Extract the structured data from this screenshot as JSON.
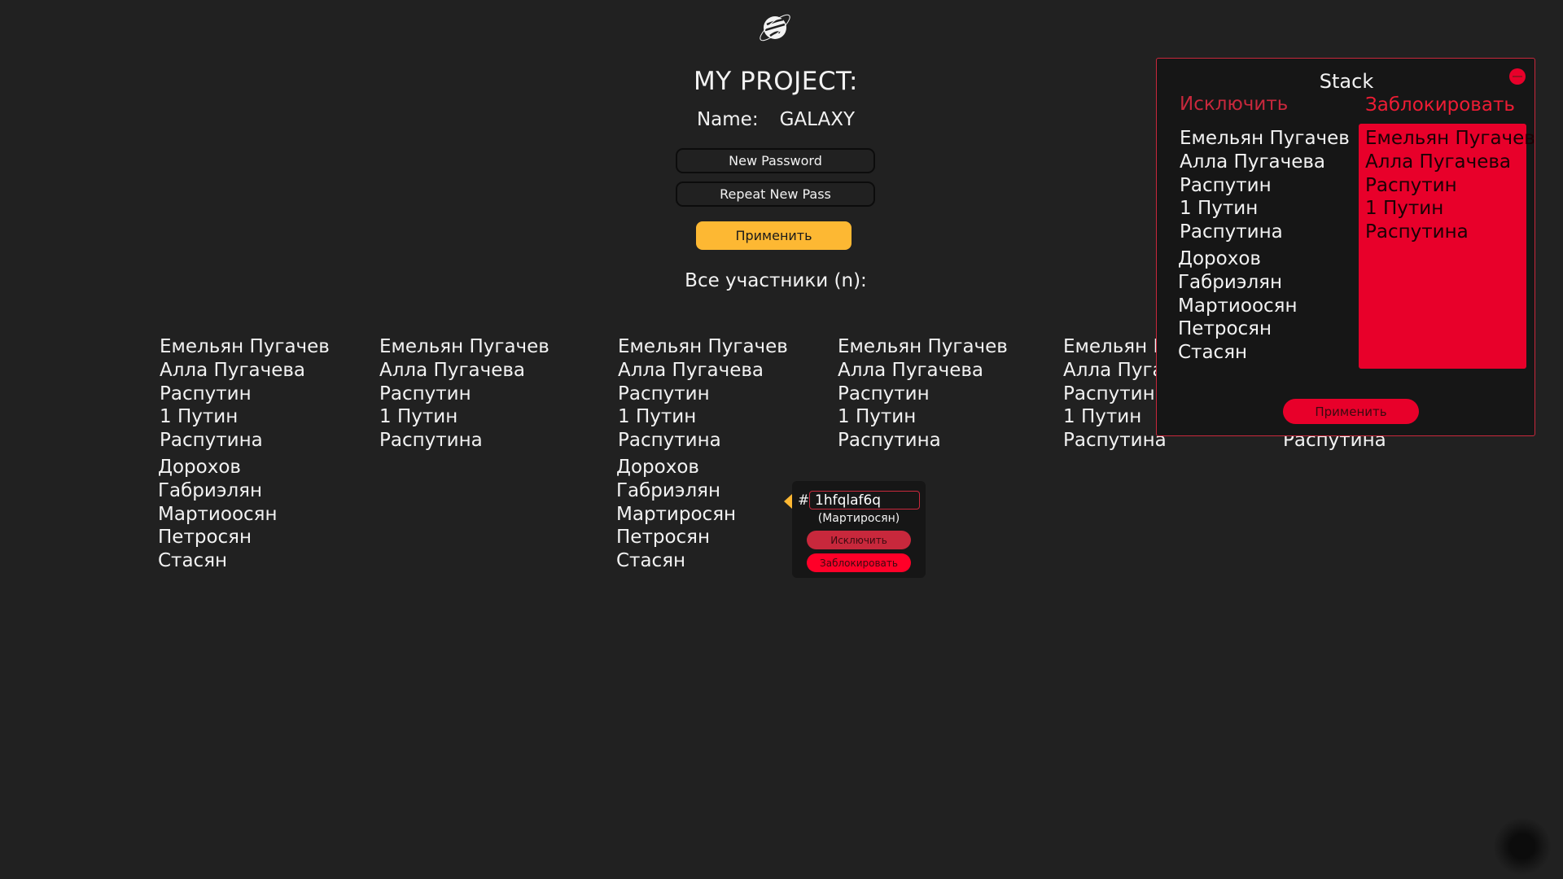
{
  "header": {
    "logo": "planet-logo",
    "title": "MY PROJECT:",
    "name_label": "Name:",
    "name_value": "GALAXY"
  },
  "form": {
    "new_password_placeholder": "New Password",
    "repeat_password_placeholder": "Repeat New Pass",
    "apply_label": "Применить",
    "accent": "#fdb833"
  },
  "members": {
    "title": "Все участники (n):",
    "columns": [
      {
        "group1": [
          "Емельян Пугачев",
          "Алла Пугачева",
          "Распутин",
          "1 Путин",
          "Распутина"
        ],
        "group2": [
          "Дорохов",
          "Габриэлян",
          "Мартиоосян",
          "Петросян",
          "Стасян"
        ]
      },
      {
        "group1": [
          "Емельян Пугачев",
          "Алла Пугачева",
          "Распутин",
          "1 Путин",
          "Распутина"
        ]
      },
      {
        "group1": [
          "Емельян Пугачев",
          "Алла Пугачева",
          "Распутин",
          "1 Путин",
          "Распутина"
        ],
        "group2": [
          "Дорохов",
          "Габриэлян",
          "Мартиросян",
          "Петросян",
          "Стасян"
        ]
      },
      {
        "group1": [
          "Емельян Пугачев",
          "Алла Пугачева",
          "Распутин",
          "1 Путин",
          "Распутина"
        ]
      },
      {
        "group1": [
          "Емельян Пугачев",
          "Алла Пугачева",
          "Распутин",
          "1 Путин",
          "Распутина"
        ]
      },
      {
        "group1": [
          "Распутина"
        ]
      }
    ]
  },
  "popup": {
    "hash": "#",
    "id_value": "1hfqlaf6q",
    "name": "(Мартиросян)",
    "exclude_label": "Исключить",
    "block_label": "Заблокировать"
  },
  "stack": {
    "title": "Stack",
    "exclude_header": "Исключить",
    "block_header": "Заблокировать",
    "exclude_group1": [
      "Емельян Пугачев",
      "Алла Пугачева",
      "Распутин",
      "1 Путин",
      "Распутина"
    ],
    "exclude_group2": [
      "Дорохов",
      "Габриэлян",
      "Мартиоосян",
      "Петросян",
      "Стасян"
    ],
    "block_list": [
      "Емельян Пугачев",
      "Алла Пугачева",
      "Распутин",
      "1 Путин",
      "Распутина"
    ],
    "apply_label": "Применить",
    "accent": "#e8002a"
  }
}
